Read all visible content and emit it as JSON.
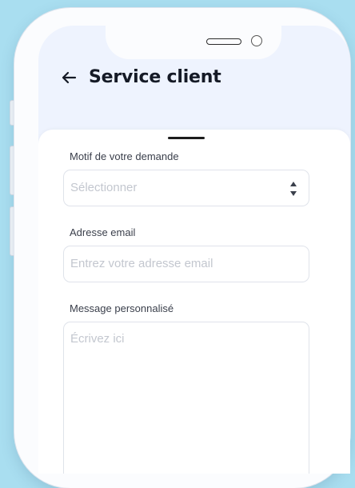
{
  "header": {
    "back_icon": "arrow-left-icon",
    "title": "Service client"
  },
  "form": {
    "reason_label": "Motif de votre demande",
    "reason_placeholder": "Sélectionner",
    "reason_icon": "select-arrows-icon",
    "email_label": "Adresse email",
    "email_placeholder": "Entrez votre adresse email",
    "message_label": "Message personnalisé",
    "message_placeholder": "Écrivez ici"
  },
  "colors": {
    "background": "#a9def0",
    "header_bg": "#eef3fe",
    "title": "#151a26",
    "placeholder": "#c3c7cf"
  }
}
